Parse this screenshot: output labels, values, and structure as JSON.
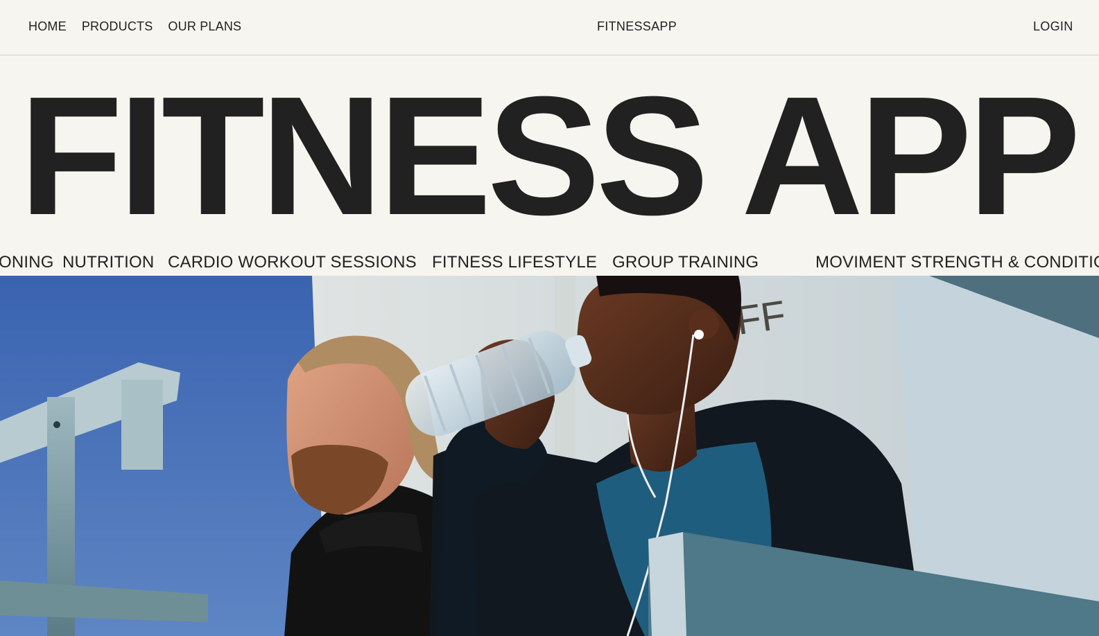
{
  "nav": {
    "links": [
      "HOME",
      "PRODUCTS",
      "OUR PLANS"
    ],
    "brand": "FITNESSAPP",
    "login": "LOGIN"
  },
  "hero": {
    "title": "FITNESS APP"
  },
  "marquee": {
    "items": [
      "ONING",
      "NUTRITION",
      "CARDIO WORKOUT SESSIONS",
      "FITNESS LIFESTYLE",
      "GROUP TRAINING",
      "MOVIMENT STRENGTH & CONDITIO"
    ]
  },
  "photo": {
    "sign_text": "FF"
  },
  "colors": {
    "background": "#f7f5ef",
    "text": "#212121",
    "sky": "#3a5fa0"
  }
}
